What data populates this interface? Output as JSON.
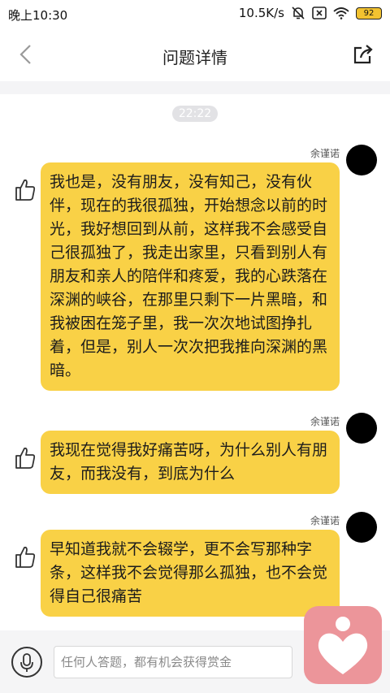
{
  "status_bar": {
    "time": "晚上10:30",
    "speed": "10.5K/s",
    "battery": "92",
    "icons": [
      "bell-off-icon",
      "sim-x-icon",
      "wifi-icon",
      "battery-icon"
    ]
  },
  "header": {
    "title": "问题详情",
    "back_icon": "chevron-left-icon",
    "share_icon": "share-icon"
  },
  "thread": {
    "timestamp": "22:22",
    "messages": [
      {
        "username": "余谨诺",
        "text": "我也是，没有朋友，没有知己，没有伙伴，现在的我很孤独，开始想念以前的时光，我好想回到从前，这样我不会感受自己很孤独了，我走出家里，只看到别人有朋友和亲人的陪伴和疼爱，我的心跌落在深渊的峡谷，在那里只剩下一片黑暗，和我被困在笼子里，我一次次地试图挣扎着，但是，别人一次次把我推向深渊的黑暗。"
      },
      {
        "username": "余谨诺",
        "text": "我现在觉得我好痛苦呀，为什么别人有朋友，而我没有，到底为什么"
      },
      {
        "username": "余谨诺",
        "text": "早知道我就不会辍学，更不会写那种字条，这样我不会觉得那么孤独，也不会觉得自己很痛苦"
      }
    ]
  },
  "footer": {
    "input_placeholder": "任何人答题，都有机会获得赏金",
    "mic_icon": "microphone-icon"
  },
  "colors": {
    "bubble": "#f9d146",
    "app_icon": "#ec959a"
  }
}
